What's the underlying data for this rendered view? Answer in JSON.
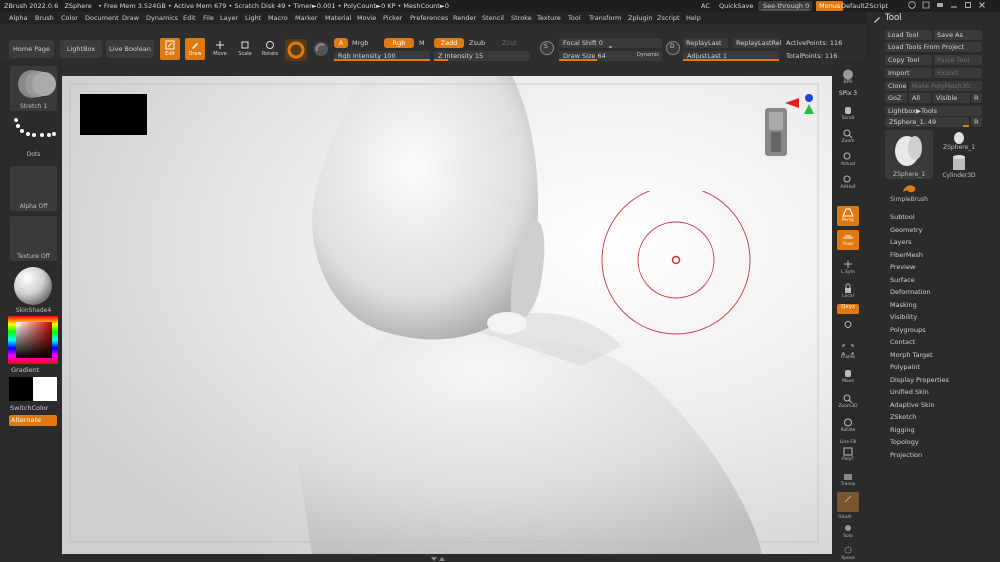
{
  "titlebar": {
    "app": "ZBrush 2022.0.6",
    "doc": "ZSphere",
    "stats": "• Free Mem 3.524GB • Active Mem 679 • Scratch Disk 49 • Timer►0.001 • PolyCount►0 KP • MeshCount►0",
    "ac": "AC",
    "quicksave": "QuickSave",
    "seethrough": "See-through  0",
    "menus": "Menus",
    "default_zscript": "DefaultZScript"
  },
  "menubar": [
    "Alpha",
    "Brush",
    "Color",
    "Document",
    "Draw",
    "Dynamics",
    "Edit",
    "File",
    "Layer",
    "Light",
    "Macro",
    "Marker",
    "Material",
    "Movie",
    "Picker",
    "Preferences",
    "Render",
    "Stencil",
    "Stroke",
    "Texture",
    "Tool",
    "Transform",
    "Zplugin",
    "Zscript",
    "Help"
  ],
  "shelf": {
    "home_page": "Home Page",
    "lightbox": "LightBox",
    "live_boolean": "Live Boolean",
    "edit": "Edit",
    "draw": "Draw",
    "move": "Move",
    "scale": "Scale",
    "rotate": "Rotate",
    "a": "A",
    "mrgb": "Mrgb",
    "rgb": "Rgb",
    "m": "M",
    "rgb_intensity": "Rgb Intensity 100",
    "zadd": "Zadd",
    "zsub": "Zsub",
    "zcut": "Zcut",
    "z_intensity": "Z Intensity 15",
    "z_intensity_value": 0.15,
    "focal_shift": "Focal Shift 0",
    "draw_size": "Draw Size 64",
    "dynamic": "Dynamic",
    "s_badge": "S",
    "d_badge": "D",
    "replay_last": "ReplayLast",
    "replay_last_rel": "ReplayLastRel",
    "adjust_last": "AdjustLast 1",
    "active_points": "ActivePoints: 116",
    "total_points": "TotalPoints: 116"
  },
  "left": {
    "stroke": "Stretch 1",
    "alpha_dots": "Dots",
    "alpha": "Alpha Off",
    "texture": "Texture Off",
    "material": "SkinShade4",
    "gradient": "Gradient",
    "switchcolor": "SwitchColor",
    "alternate": "Alternate"
  },
  "rstrip": {
    "bpr": "BPR",
    "spix": "SPix 3",
    "scroll": "Scroll",
    "zoom": "Zoom",
    "actual": "Actual",
    "aahalf": "AAHalf",
    "persp": "Persp",
    "floor": "Floor",
    "lsym": "L.Sym",
    "local": "Local",
    "qxyz": "Qxyz",
    "frame": "Frame",
    "move": "Move",
    "zoom3d": "Zoom3D",
    "rotate": "Rotate",
    "linefill": "Line Fill",
    "polyf": "PolyF",
    "transp": "Transp",
    "ghost": "Ghost",
    "solo": "Solo",
    "xpose": "Xpose"
  },
  "tool": {
    "title": "Tool",
    "load_tool": "Load Tool",
    "save_as": "Save As",
    "load_from_project": "Load Tools From Project",
    "copy_tool": "Copy Tool",
    "paste_tool": "Paste Tool",
    "import": "Import",
    "export": "Export",
    "clone": "Clone",
    "make_polymesh": "Make PolyMesh3D",
    "goz": "GoZ",
    "all": "All",
    "visible": "Visible",
    "r": "R",
    "lightbox_tools": "Lightbox▶Tools",
    "current_tool": "ZSphere_1. 49",
    "thumbs": [
      "ZSphere_1",
      "ZSphere_1",
      "Cylinder3D",
      "SimpleBrush"
    ],
    "subpalettes": [
      "Subtool",
      "Geometry",
      "Layers",
      "FiberMesh",
      "Preview",
      "Surface",
      "Deformation",
      "Masking",
      "Visibility",
      "Polygroups",
      "Contact",
      "Morph Target",
      "Polypaint",
      "Display Properties",
      "Unified Skin",
      "Adaptive Skin",
      "ZSketch",
      "Rigging",
      "Topology",
      "Projection"
    ]
  },
  "colors": {
    "accent": "#e07a10",
    "panel": "#2b2b2b",
    "button": "#3a3a3a",
    "canvas": "#e4e4e4",
    "brush_ring": "#c8323c"
  }
}
